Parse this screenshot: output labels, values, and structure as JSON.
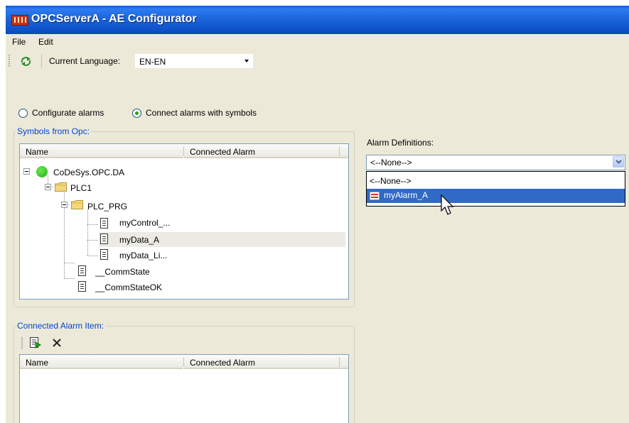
{
  "window": {
    "title": "OPCServerA - AE Configurator"
  },
  "menu": {
    "file": "File",
    "edit": "Edit"
  },
  "toolbar": {
    "language_label": "Current Language:",
    "language_value": "EN-EN"
  },
  "mode": {
    "configurate_label": "Configurate alarms",
    "connect_label": "Connect alarms with symbols",
    "selected": "Connect alarms with symbols"
  },
  "symbols": {
    "group_title": "Symbols from Opc:",
    "col_name": "Name",
    "col_connected": "Connected Alarm",
    "tree": {
      "root": "CoDeSys.OPC.DA",
      "plc": "PLC1",
      "prg": "PLC_PRG",
      "item1": "myControl_...",
      "item2": "myData_A",
      "item3": "myData_Li...",
      "commstate": "__CommState",
      "commstateok": "__CommStateOK"
    }
  },
  "alarms": {
    "label": "Alarm Definitions:",
    "selected": "<--None-->",
    "options": [
      "<--None-->",
      "myAlarm_A"
    ],
    "highlighted": "myAlarm_A"
  },
  "connected": {
    "group_title": "Connected Alarm Item:",
    "col_name": "Name",
    "col_connected": "Connected Alarm"
  }
}
